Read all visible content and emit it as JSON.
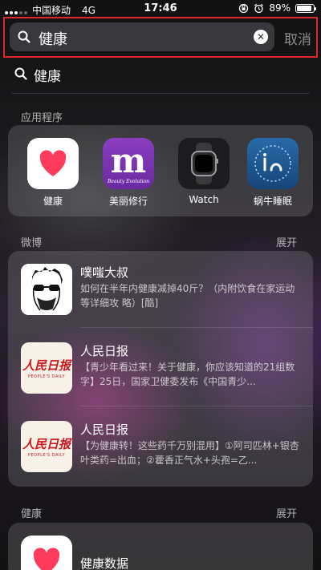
{
  "status_bar": {
    "carrier": "中国移动",
    "network": "4G",
    "time": "17:46",
    "battery": "89%",
    "battery_level": 0.89
  },
  "search": {
    "value": "健康",
    "cancel_label": "取消"
  },
  "suggestion": {
    "text": "健康"
  },
  "apps_section": {
    "title": "应用程序",
    "apps": [
      {
        "label": "健康",
        "icon": "heart-icon"
      },
      {
        "label": "美丽修行",
        "icon": "m-logo-icon",
        "logo_letter": "m",
        "tagline": "Beauty Evolution"
      },
      {
        "label": "Watch",
        "icon": "apple-watch-icon"
      },
      {
        "label": "蜗牛睡眠",
        "icon": "snail-sleep-icon"
      }
    ]
  },
  "weibo_section": {
    "title": "微博",
    "expand": "展开",
    "posts": [
      {
        "title": "噗嗤大叔",
        "body": "如何在半年内健康减掉40斤？（内附饮食在家运动等详细攻 略）[酷]"
      },
      {
        "title": "人民日报",
        "body": "【青少年看过来！关于健康，你应该知道的21组数字】25日，国家卫健委发布《中国青少...",
        "logo_text": "人民日报",
        "logo_en": "PEOPLE'S DAILY"
      },
      {
        "title": "人民日报",
        "body": "【为健康转！这些药千万别混用】①阿司匹林+银杏叶类药=出血；②藿香正气水+头孢=乙...",
        "logo_text": "人民日报",
        "logo_en": "PEOPLE'S DAILY"
      }
    ]
  },
  "health_section": {
    "title": "健康",
    "expand": "展开",
    "item_title": "健康数据"
  },
  "colors": {
    "highlight_border": "#e0262e",
    "heart": "#ff3b5c",
    "rmrb_red": "#c9161c"
  }
}
